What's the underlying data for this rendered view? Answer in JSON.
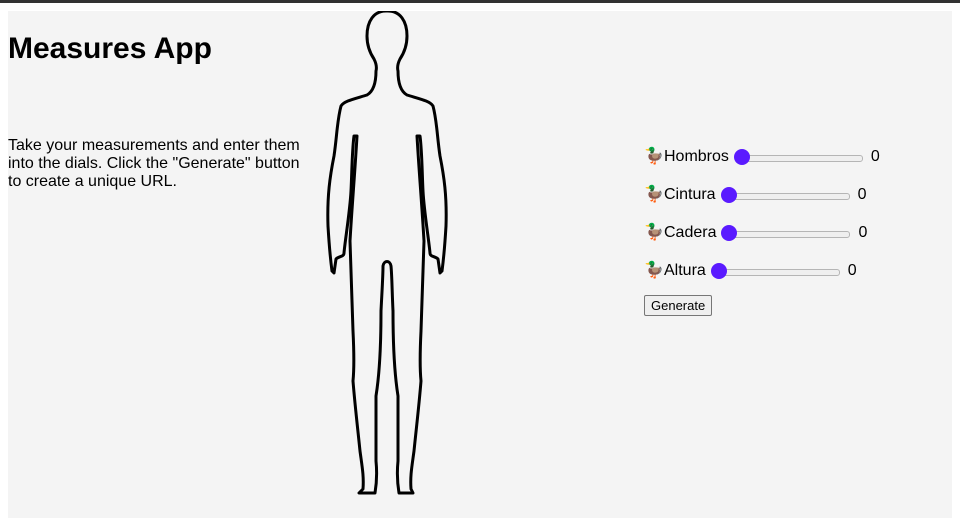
{
  "app": {
    "title": "Measures App",
    "description": "Take your measurements and enter them into the dials. Click the \"Generate\" button to create a unique URL."
  },
  "figure": {
    "icon": "human-body-outline"
  },
  "sliders": [
    {
      "icon": "🦆",
      "label": "Hombros",
      "value": "0"
    },
    {
      "icon": "🦆",
      "label": "Cintura",
      "value": "0"
    },
    {
      "icon": "🦆",
      "label": "Cadera",
      "value": "0"
    },
    {
      "icon": "🦆",
      "label": "Altura",
      "value": "0"
    }
  ],
  "generate_button": {
    "label": "Generate"
  },
  "colors": {
    "thumb": "#5a1aff",
    "panel": "#f4f4f4"
  }
}
